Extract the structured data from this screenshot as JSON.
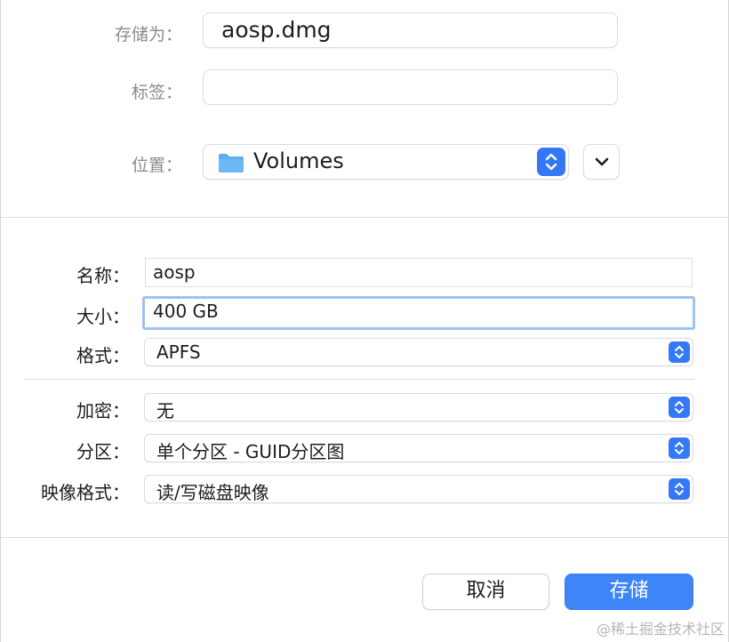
{
  "save_as": {
    "label": "存储为：",
    "value": "aosp.dmg"
  },
  "tags": {
    "label": "标签：",
    "value": ""
  },
  "location": {
    "label": "位置：",
    "value": "Volumes",
    "icon": "folder-icon"
  },
  "name": {
    "label": "名称：",
    "value": "aosp"
  },
  "size": {
    "label": "大小：",
    "value": "400 GB"
  },
  "format": {
    "label": "格式：",
    "value": "APFS"
  },
  "encryption": {
    "label": "加密：",
    "value": "无"
  },
  "partition": {
    "label": "分区：",
    "value": "单个分区 - GUID分区图"
  },
  "image_format": {
    "label": "映像格式：",
    "value": "读/写磁盘映像"
  },
  "buttons": {
    "cancel": "取消",
    "save": "存储"
  },
  "watermark": "@稀土掘金技术社区",
  "colors": {
    "accent": "#3478f6",
    "save_button": "#3e85f7",
    "focus_ring": "#9ec3f3"
  }
}
